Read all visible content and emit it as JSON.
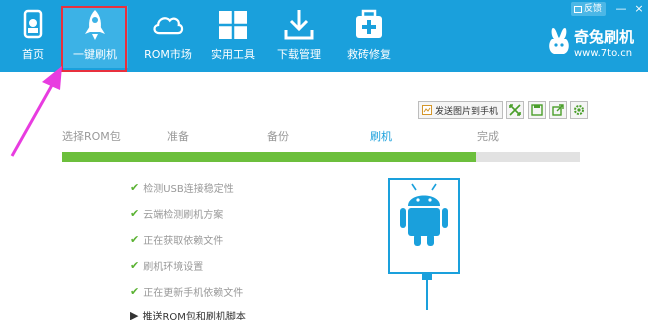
{
  "nav": {
    "items": [
      {
        "label": "首页",
        "icon": "home-icon"
      },
      {
        "label": "一键刷机",
        "icon": "rocket-icon"
      },
      {
        "label": "ROM市场",
        "icon": "cloud-icon"
      },
      {
        "label": "实用工具",
        "icon": "grid-icon"
      },
      {
        "label": "下载管理",
        "icon": "download-icon"
      },
      {
        "label": "救砖修复",
        "icon": "first-aid-icon"
      }
    ]
  },
  "window": {
    "feedback_label": "反馈",
    "minimize": "—",
    "close": "×"
  },
  "brand": {
    "name": "奇兔刷机",
    "url": "www.7to.cn"
  },
  "toolbar": {
    "send_label": "发送图片到手机"
  },
  "steps": [
    "选择ROM包",
    "准备",
    "备份",
    "刷机",
    "完成"
  ],
  "current_step": "刷机",
  "progress": 0.8,
  "checklist": [
    {
      "label": "检测USB连接稳定性",
      "done": true
    },
    {
      "label": "云端检测刷机方案",
      "done": true
    },
    {
      "label": "正在获取依赖文件",
      "done": true
    },
    {
      "label": "刷机环境设置",
      "done": true
    },
    {
      "label": "正在更新手机依赖文件",
      "done": true
    },
    {
      "label": "推送ROM包和刷机脚本",
      "done": false
    }
  ],
  "colors": {
    "topbar": "#1aa0dc",
    "progress": "#6cbf3c",
    "highlight_frame": "#e8303d",
    "annotation_arrow": "#e83ce0"
  }
}
